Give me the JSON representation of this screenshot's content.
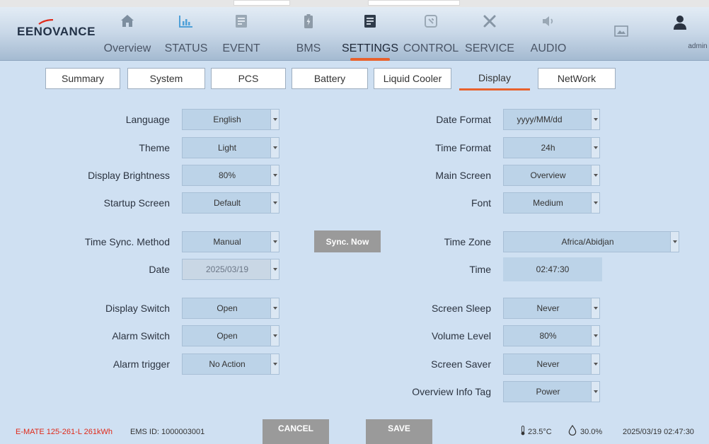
{
  "brand": {
    "logo_text": "EENOVANCE"
  },
  "nav": [
    {
      "label": "Overview",
      "icon": "home-icon"
    },
    {
      "label": "STATUS",
      "icon": "chart-icon"
    },
    {
      "label": "EVENT",
      "icon": "event-log-icon"
    },
    {
      "label": "BMS",
      "icon": "battery-icon"
    },
    {
      "label": "SETTINGS",
      "icon": "settings-list-icon",
      "active": true
    },
    {
      "label": "CONTROL",
      "icon": "control-icon"
    },
    {
      "label": "SERVICE",
      "icon": "tools-icon"
    },
    {
      "label": "AUDIO",
      "icon": "speaker-icon"
    }
  ],
  "header": {
    "screenshot_icon": "image-frame-icon",
    "user": {
      "label": "admin",
      "icon": "user-icon"
    }
  },
  "tabs": [
    "Summary",
    "System",
    "PCS",
    "Battery",
    "Liquid Cooler",
    "Display",
    "NetWork"
  ],
  "active_tab": "Display",
  "form": {
    "language": {
      "label": "Language",
      "value": "English"
    },
    "theme": {
      "label": "Theme",
      "value": "Light"
    },
    "brightness": {
      "label": "Display Brightness",
      "value": "80%"
    },
    "startup": {
      "label": "Startup Screen",
      "value": "Default"
    },
    "time_sync": {
      "label": "Time Sync. Method",
      "value": "Manual"
    },
    "sync_now": "Sync. Now",
    "date": {
      "label": "Date",
      "value": "2025/03/19"
    },
    "display_switch": {
      "label": "Display Switch",
      "value": "Open"
    },
    "alarm_switch": {
      "label": "Alarm Switch",
      "value": "Open"
    },
    "alarm_trigger": {
      "label": "Alarm trigger",
      "value": "No Action"
    },
    "date_format": {
      "label": "Date Format",
      "value": "yyyy/MM/dd"
    },
    "time_format": {
      "label": "Time Format",
      "value": "24h"
    },
    "main_screen": {
      "label": "Main Screen",
      "value": "Overview"
    },
    "font": {
      "label": "Font",
      "value": "Medium"
    },
    "time_zone": {
      "label": "Time Zone",
      "value": "Africa/Abidjan"
    },
    "time": {
      "label": "Time",
      "value": "02:47:30"
    },
    "screen_sleep": {
      "label": "Screen Sleep",
      "value": "Never"
    },
    "volume": {
      "label": "Volume Level",
      "value": "80%"
    },
    "screen_saver": {
      "label": "Screen Saver",
      "value": "Never"
    },
    "info_tag": {
      "label": "Overview Info Tag",
      "value": "Power"
    }
  },
  "buttons": {
    "cancel": "CANCEL",
    "save": "SAVE"
  },
  "footer": {
    "model": "E-MATE 125-261-L 261kWh",
    "ems_id": "EMS ID: 1000003001",
    "temperature": "23.5°C",
    "humidity": "30.0%",
    "datetime": "2025/03/19 02:47:30"
  },
  "colors": {
    "accent": "#e8612c",
    "header_top": "#e3ecf5",
    "header_bottom": "#a4bad1",
    "body_bg": "#cfe0f2",
    "field_bg": "#bcd3e8",
    "button_gray": "#9a9a9a",
    "model_red": "#e02a1a"
  }
}
